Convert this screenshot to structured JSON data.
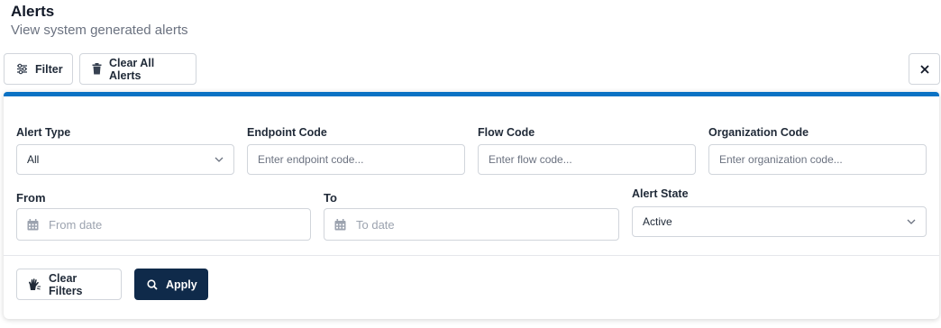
{
  "header": {
    "title": "Alerts",
    "subtitle": "View system generated alerts"
  },
  "toolbar": {
    "filter_label": "Filter",
    "clear_all_label": "Clear All Alerts",
    "close_icon": "close-icon"
  },
  "filters": {
    "alert_type": {
      "label": "Alert Type",
      "value": "All"
    },
    "endpoint_code": {
      "label": "Endpoint Code",
      "placeholder": "Enter endpoint code..."
    },
    "flow_code": {
      "label": "Flow Code",
      "placeholder": "Enter flow code..."
    },
    "organization_code": {
      "label": "Organization Code",
      "placeholder": "Enter organization code..."
    },
    "from": {
      "label": "From",
      "placeholder": "From date"
    },
    "to": {
      "label": "To",
      "placeholder": "To date"
    },
    "alert_state": {
      "label": "Alert State",
      "value": "Active"
    }
  },
  "actions": {
    "clear_filters_label": "Clear Filters",
    "apply_label": "Apply"
  },
  "colors": {
    "accent_bar": "#0b72c4",
    "primary_button": "#0f2a4a"
  }
}
